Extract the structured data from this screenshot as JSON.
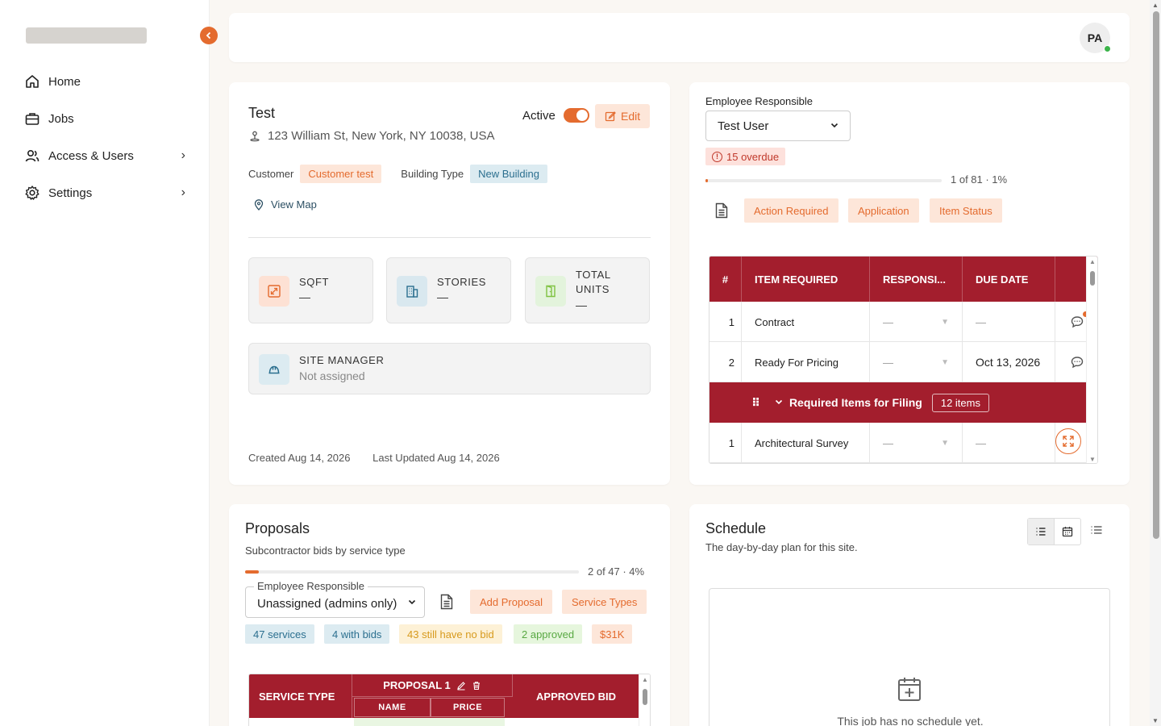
{
  "sidebar": {
    "items": [
      {
        "label": "Home",
        "icon": "home-icon",
        "has_chevron": false
      },
      {
        "label": "Jobs",
        "icon": "briefcase-icon",
        "has_chevron": false
      },
      {
        "label": "Access & Users",
        "icon": "users-icon",
        "has_chevron": true
      },
      {
        "label": "Settings",
        "icon": "gear-icon",
        "has_chevron": true
      }
    ],
    "collapse_icon": "chevron-left-icon"
  },
  "topbar": {
    "avatar_initials": "PA",
    "status_color": "#3bb34a"
  },
  "job": {
    "title": "Test",
    "address": "123 William St, New York, NY 10038, USA",
    "active_label": "Active",
    "active": true,
    "edit_label": "Edit",
    "customer_label": "Customer",
    "customer_value": "Customer test",
    "building_type_label": "Building Type",
    "building_type_value": "New Building",
    "view_map_label": "View Map",
    "stats": [
      {
        "label": "SQFT",
        "value": "—",
        "icon": "expand-square-icon"
      },
      {
        "label": "STORIES",
        "value": "—",
        "icon": "building-icon"
      },
      {
        "label": "TOTAL UNITS",
        "value": "—",
        "icon": "door-icon"
      }
    ],
    "site_manager_label": "SITE MANAGER",
    "site_manager_value": "Not assigned",
    "created": "Created Aug 14, 2026",
    "updated": "Last Updated Aug 14, 2026"
  },
  "filing": {
    "employee_label": "Employee Responsible",
    "employee_value": "Test User",
    "overdue_label": "15 overdue",
    "progress_text": "1 of 81 · 1%",
    "progress_fraction": 0.01,
    "chips": [
      "Action Required",
      "Application",
      "Item Status"
    ],
    "table": {
      "headers": [
        "#",
        "ITEM REQUIRED",
        "RESPONSI...",
        "DUE DATE"
      ],
      "rows": [
        {
          "num": "1",
          "item": "Contract",
          "responsible": "—",
          "due": "—",
          "has_badge": true
        },
        {
          "num": "2",
          "item": "Ready For Pricing",
          "responsible": "—",
          "due": "Oct 13, 2026",
          "has_badge": false
        }
      ],
      "group": {
        "label": "Required Items for Filing",
        "count": "12 items"
      },
      "group_rows": [
        {
          "num": "1",
          "item": "Architectural Survey",
          "responsible": "—",
          "due": "—"
        }
      ]
    }
  },
  "proposals": {
    "title": "Proposals",
    "subtitle": "Subcontractor bids by service type",
    "progress_text": "2 of 47 · 4%",
    "progress_fraction": 0.04,
    "employee_label": "Employee Responsible",
    "employee_value": "Unassigned (admins only)",
    "add_label": "Add Proposal",
    "service_types_label": "Service Types",
    "stat_chips": [
      {
        "label": "47 services",
        "bg": "#dcebf1",
        "fg": "#2b6f8f"
      },
      {
        "label": "4 with bids",
        "bg": "#dcebf1",
        "fg": "#2b6f8f"
      },
      {
        "label": "43 still have no bid",
        "bg": "#fdf1d6",
        "fg": "#d79a1d"
      },
      {
        "label": "2 approved",
        "bg": "#e6f6dd",
        "fg": "#58a842"
      },
      {
        "label": "$31K",
        "bg": "#fde6d9",
        "fg": "#e46b2e"
      }
    ],
    "table": {
      "service_type": "SERVICE TYPE",
      "proposal": "PROPOSAL 1",
      "name": "NAME",
      "price": "PRICE",
      "approved": "APPROVED BID"
    }
  },
  "schedule": {
    "title": "Schedule",
    "subtitle": "The day-by-day plan for this site.",
    "empty_message": "This job has no schedule yet."
  },
  "colors": {
    "accent": "#e46b2e",
    "header_red": "#a31e2d"
  }
}
